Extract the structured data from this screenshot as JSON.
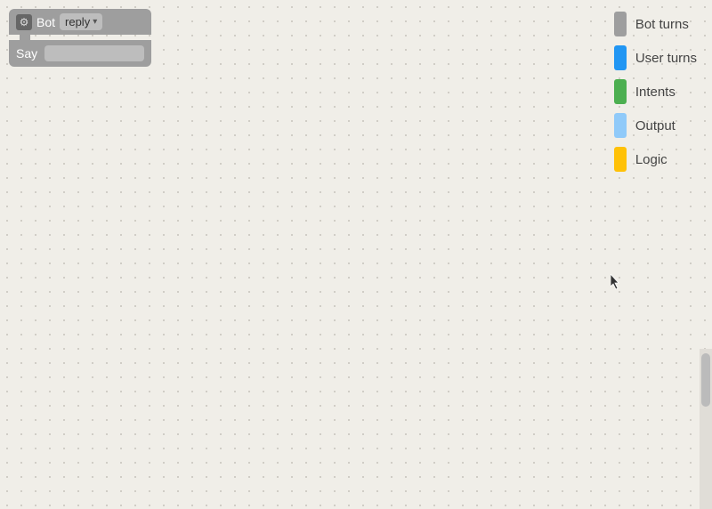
{
  "canvas": {
    "background": "#f0eee8"
  },
  "botBlock": {
    "gearIcon": "⚙",
    "label": "Bot",
    "dropdownValue": "reply",
    "dropdownArrow": "▾"
  },
  "sayBlock": {
    "label": "Say",
    "inputValue": ""
  },
  "legend": {
    "items": [
      {
        "id": "bot-turns",
        "label": "Bot turns",
        "color": "#9e9e9e"
      },
      {
        "id": "user-turns",
        "label": "User turns",
        "color": "#2196F3"
      },
      {
        "id": "intents",
        "label": "Intents",
        "color": "#4CAF50"
      },
      {
        "id": "output",
        "label": "Output",
        "color": "#90CAF9"
      },
      {
        "id": "logic",
        "label": "Logic",
        "color": "#FFC107"
      }
    ]
  }
}
